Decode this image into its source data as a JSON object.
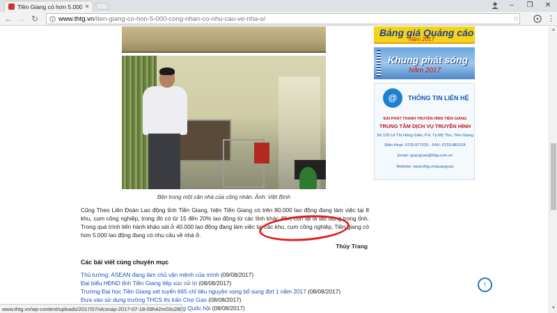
{
  "browser": {
    "tab_title": "Tiền Giang có hơn 5.000",
    "url_domain": "www.thtg.vn",
    "url_path": "/tien-giang-co-hon-5-000-cong-nhan-co-nhu-cau-ve-nha-o/",
    "status_url": "www.thtg.vn/wp-content/uploads/2017/07/vlcsnap-2017-07-18-09h42m03s280.jpg"
  },
  "article": {
    "caption": "Bên trong một căn nhà của công nhân. Ảnh: Việt Bình",
    "paragraph": "Cũng Theo Liên Đoàn Lao động tỉnh Tiền Giang, hiện Tiền Giang có trên 80.000 lao động đang làm việc tại 8 khu, cụm công nghiệp, trong đó có từ 15 đến 20% lao động từ các tỉnh khác đến, còn lại là lao động trong tỉnh. Trong quá trình tiến hành khảo sát ở 40.000 lao động đang làm việc tại các khu, cụm công nghiệp, Tiền giang có hơn 5.000 lao động đang có nhu cầu về nhà ở.",
    "author": "Thùy Trang"
  },
  "related": {
    "title": "Các bài viết cùng chuyên mục",
    "items": [
      {
        "text": "Thủ tướng: ASEAN đang làm chủ vận mệnh của mình",
        "date": "(09/08/2017)"
      },
      {
        "text": "Đại biểu HĐND tỉnh Tiền Giang tiếp xúc cử tri",
        "date": "(08/08/2017)"
      },
      {
        "text": "Trường Đại học Tiền Giang xét tuyển 665 chỉ tiêu nguyện vọng bổ sung đợt 1 năm 2017",
        "date": "(08/08/2017)"
      },
      {
        "text": "Đưa vào sử dụng trường THCS thị trấn Chợ Gạo",
        "date": "(08/08/2017)"
      },
      {
        "text": "ống Quốc hội",
        "date": "(08/08/2017)"
      }
    ]
  },
  "sidebar": {
    "ad1": {
      "line1": "Bảng giá Quảng cáo",
      "line2": "Năm 2017"
    },
    "ad2": {
      "line1": "Khung phát sóng",
      "line2": "Năm 2017"
    },
    "contact": {
      "title": "THÔNG TIN LIÊN HỆ",
      "org1": "ĐÀI PHÁT THANH TRUYỀN HÌNH TIỀN GIANG",
      "org2": "TRUNG TÂM DỊCH VỤ TRUYỀN HÌNH",
      "address": "Số 125 Lê Thị Hồng Gấm, P.4, Tp.Mỹ Tho, Tiền Giang",
      "phone": "Điện thoại: 0733.877225 - FAX: 0733.881018",
      "email": "Email: quangcao@thtg.com.vn",
      "website": "Website: www.thtg.vn/quangcao"
    }
  },
  "colors": {
    "link": "#1a4fb8",
    "highlight_circle": "#e11b1b",
    "scroll_button": "#1e73be"
  }
}
